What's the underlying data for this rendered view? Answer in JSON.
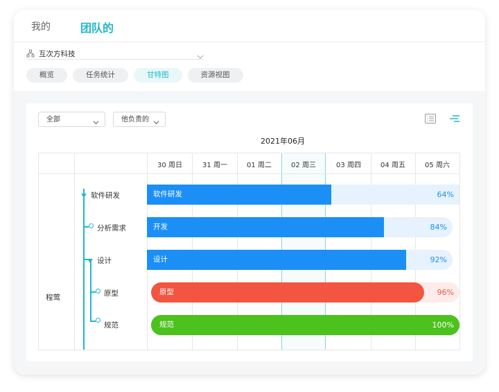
{
  "header": {
    "tab_mine": "我的",
    "tab_team": "团队的",
    "org_name": "互次方科技"
  },
  "view_tabs": [
    {
      "label": "概览",
      "active": false
    },
    {
      "label": "任务统计",
      "active": false
    },
    {
      "label": "甘特图",
      "active": true
    },
    {
      "label": "资源视图",
      "active": false
    }
  ],
  "filters": {
    "scope_value": "全部",
    "owner_value": "他负责的"
  },
  "gantt": {
    "month": "2021年06月",
    "days": [
      "30 周日",
      "31 周一",
      "01 周二",
      "02 周三",
      "03 周四",
      "04 周五",
      "05 周六"
    ],
    "today_index": 3,
    "owner": "程莺",
    "tasks": [
      {
        "name": "软件研发",
        "bar_label": "软件研发",
        "progress_label": "64%",
        "progress": 0.64,
        "color": "#1b8ff5",
        "track": "#e6f2fd",
        "pct_color": "#1b8ff5"
      },
      {
        "name": "分析需求",
        "bar_label": "开发",
        "progress_label": "84%",
        "progress": 0.84,
        "color": "#1b8ff5",
        "track": "#e6f2fd",
        "pct_color": "#1b8ff5"
      },
      {
        "name": "设计",
        "bar_label": "设计",
        "progress_label": "92%",
        "progress": 0.92,
        "color": "#1b8ff5",
        "track": "#e6f2fd",
        "pct_color": "#1b8ff5"
      },
      {
        "name": "原型",
        "bar_label": "原型",
        "progress_label": "96%",
        "progress": 0.96,
        "color": "#f25540",
        "track": "#fdecea",
        "pct_color": "#f25540"
      },
      {
        "name": "规范",
        "bar_label": "规范",
        "progress_label": "100%",
        "progress": 1.0,
        "color": "#4cc21c",
        "track": "#4cc21c",
        "pct_color": "#ffffff"
      }
    ]
  }
}
